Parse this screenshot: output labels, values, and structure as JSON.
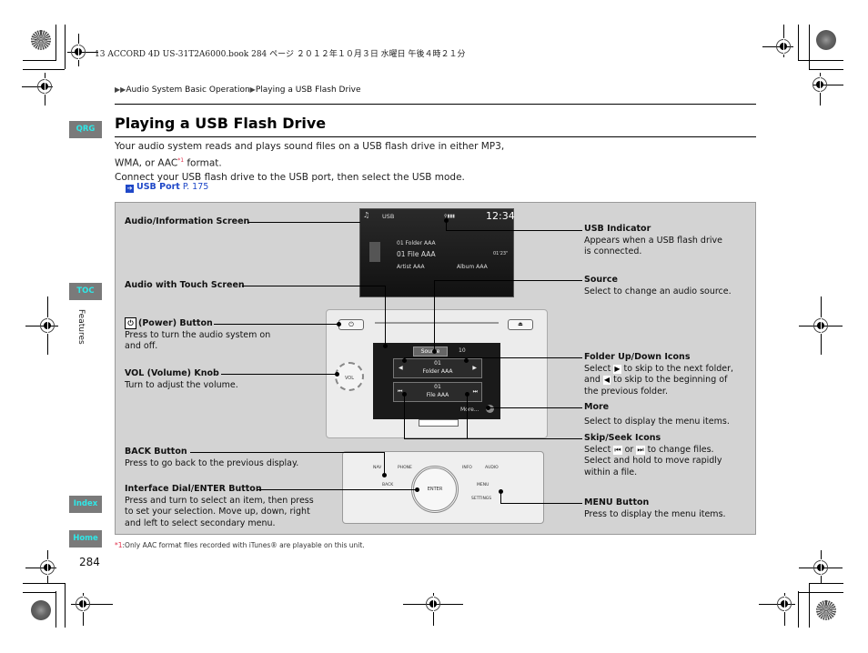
{
  "print_header": "13 ACCORD 4D US-31T2A6000.book  284 ページ  ２０１２年１０月３日  水曜日  午後４時２１分",
  "breadcrumb": {
    "items": [
      "Audio System Basic Operation",
      "Playing a USB Flash Drive"
    ]
  },
  "side_tabs": {
    "qrg": "QRG",
    "toc": "TOC",
    "index": "Index",
    "home": "Home",
    "section": "Features"
  },
  "title": "Playing a USB Flash Drive",
  "intro": {
    "line1": "Your audio system reads and plays sound files on a USB flash drive in either MP3,",
    "line2_pre": "WMA, or AAC",
    "line2_sup": "*1",
    "line2_post": " format.",
    "line3": "Connect your USB flash drive to the USB port, then select the USB mode."
  },
  "xref": {
    "label": "USB Port",
    "page": "P. 175"
  },
  "left_labels": {
    "audio_info_screen": "Audio/Information Screen",
    "touch_screen": "Audio with Touch Screen",
    "power_title": "(Power) Button",
    "power_desc1": "Press to turn the audio system on",
    "power_desc2": "and off.",
    "vol_title": "VOL (Volume) Knob",
    "vol_desc": "Turn to adjust the volume.",
    "back_title": "BACK Button",
    "back_desc": "Press to go back to the previous display.",
    "dial_title": "Interface Dial/ENTER Button",
    "dial_desc1": "Press and turn to select an item, then press",
    "dial_desc2": "to set your selection. Move up, down, right",
    "dial_desc3": "and left to select secondary menu."
  },
  "right_labels": {
    "usb_title": "USB Indicator",
    "usb_desc1": "Appears when a USB flash drive",
    "usb_desc2": "is connected.",
    "source_title": "Source",
    "source_desc": "Select to change an audio source.",
    "folder_title": "Folder Up/Down Icons",
    "folder_desc1_a": "Select",
    "folder_desc1_b": "to skip to the next folder,",
    "folder_desc2_a": "and",
    "folder_desc2_b": "to skip to the beginning of",
    "folder_desc3": "the previous folder.",
    "more_title": "More",
    "more_desc": "Select to display the menu items.",
    "skip_title": "Skip/Seek Icons",
    "skip_desc1_a": "Select",
    "skip_desc1_b": "or",
    "skip_desc1_c": "to change files.",
    "skip_desc2": "Select and hold to move rapidly",
    "skip_desc3": "within a file.",
    "menu_title": "MENU Button",
    "menu_desc": "Press to display the menu items."
  },
  "screen1": {
    "source": "USB",
    "clock": "12:34",
    "folder": "01  Folder AAA",
    "file": "01 File AAA",
    "time": "01'23\"",
    "artist": "Artist AAA",
    "album": "Album AAA"
  },
  "screen2": {
    "source_btn": "Source",
    "volume": "10",
    "folder_num": "01",
    "folder_name": "Folder AAA",
    "file_num": "01",
    "file_name": "File AAA",
    "more": "More..."
  },
  "head_unit": {
    "vol": "VOL"
  },
  "dial_unit": {
    "nav": "NAV",
    "phone": "PHONE",
    "info": "INFO",
    "audio": "AUDIO",
    "back": "BACK",
    "menu": "MENU",
    "enter": "ENTER",
    "settings": "SETTINGS"
  },
  "footnote": {
    "mark": "*1",
    "text": ":Only AAC format files recorded with iTunes® are playable on this unit."
  },
  "page_number": "284"
}
